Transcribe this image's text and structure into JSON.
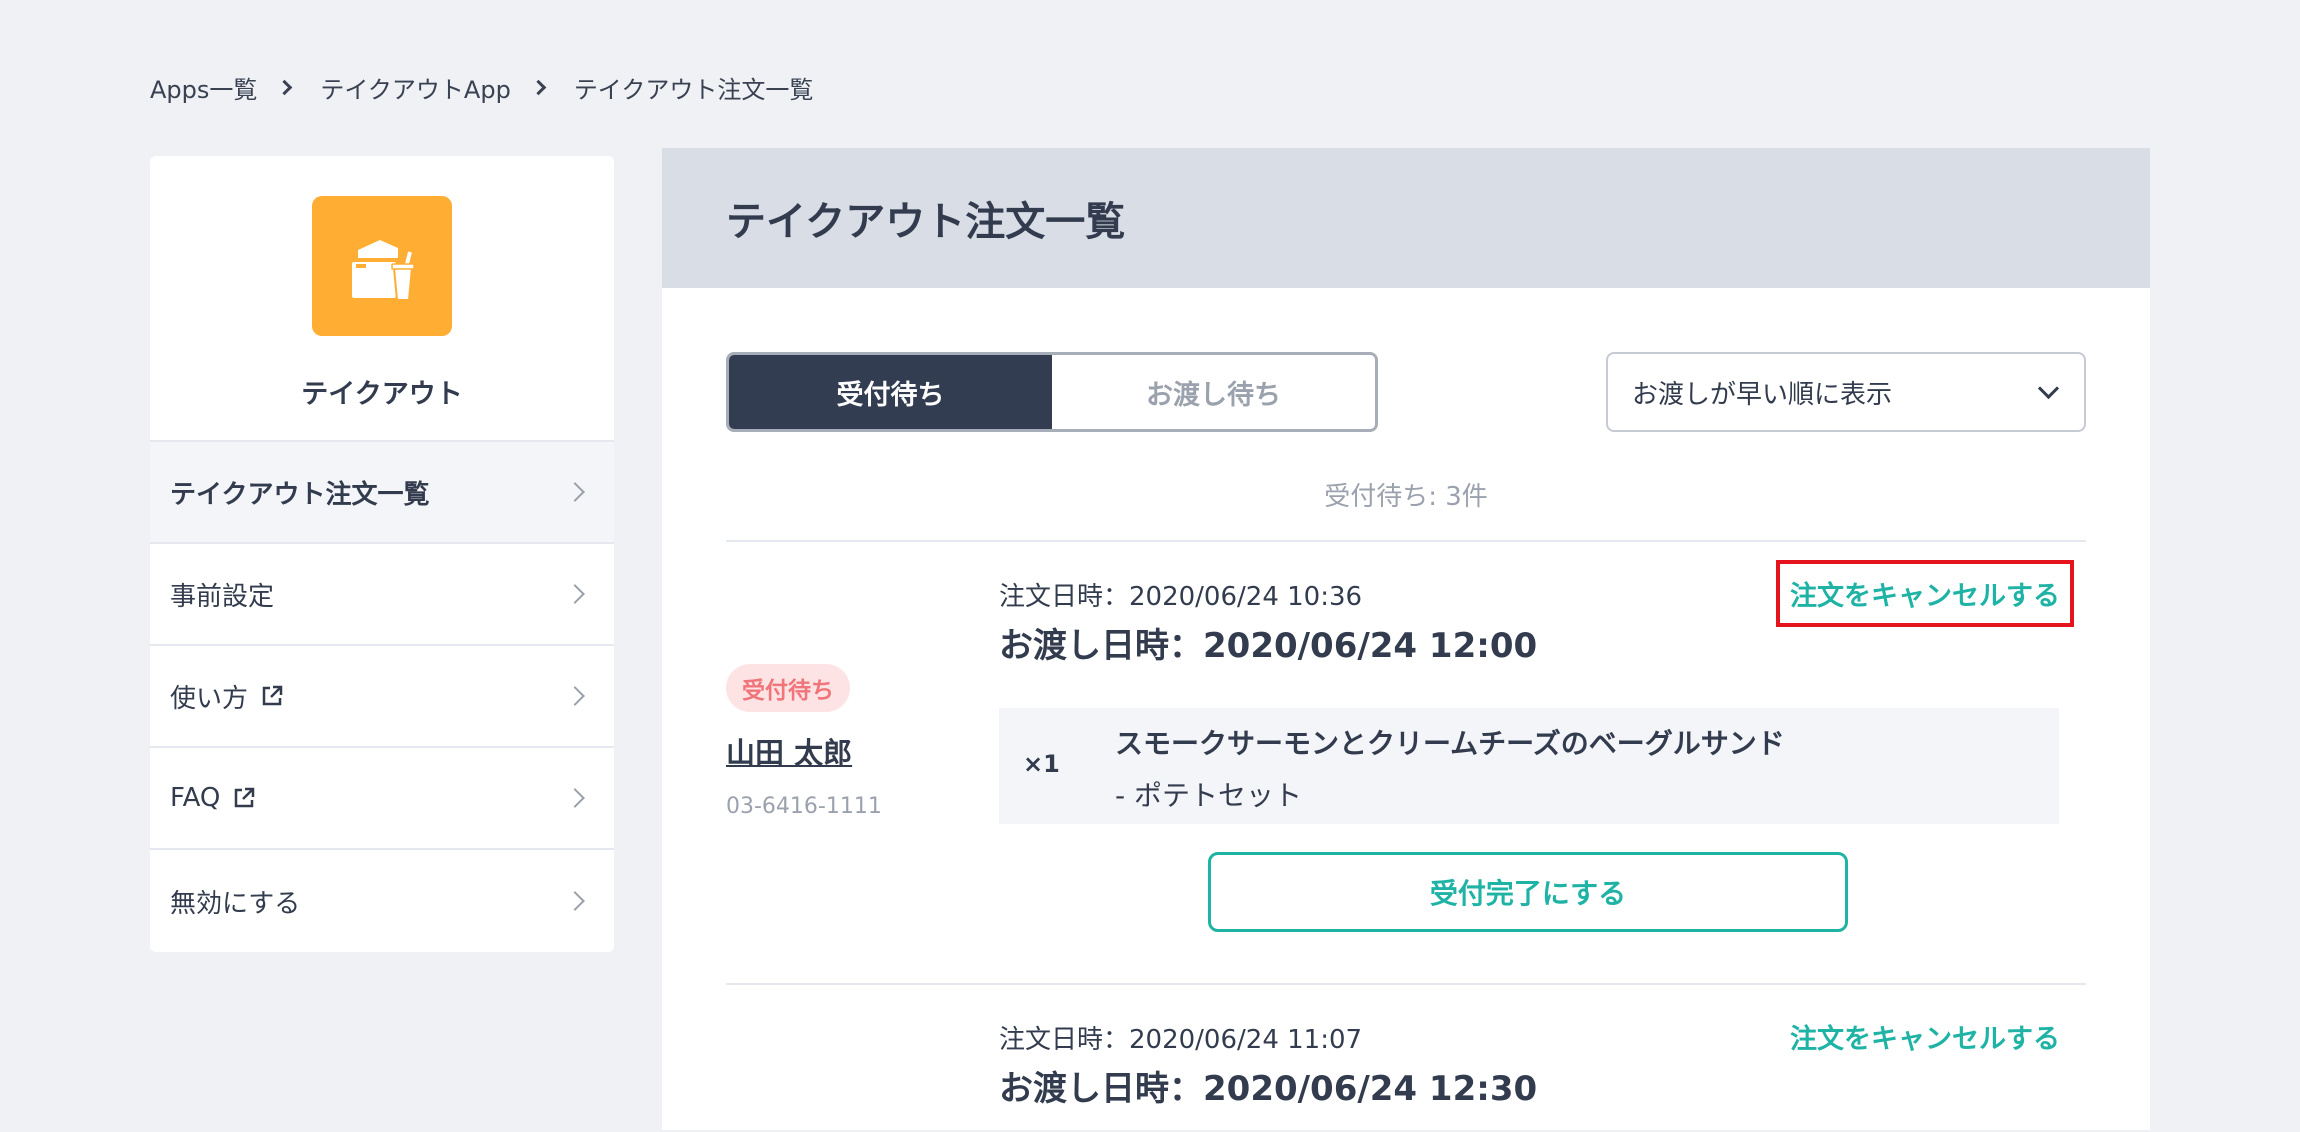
{
  "breadcrumb": {
    "items": [
      "Apps一覧",
      "テイクアウトApp",
      "テイクアウト注文一覧"
    ]
  },
  "sidebar": {
    "app_name": "テイクアウト",
    "app_icon": "takeout-bag-drink-icon",
    "app_icon_color": "#ffad33",
    "items": [
      {
        "label": "テイクアウト注文一覧",
        "external": false,
        "active": true
      },
      {
        "label": "事前設定",
        "external": false,
        "active": false
      },
      {
        "label": "使い方",
        "external": true,
        "active": false
      },
      {
        "label": "FAQ",
        "external": true,
        "active": false
      },
      {
        "label": "無効にする",
        "external": false,
        "active": false
      }
    ]
  },
  "main": {
    "title": "テイクアウト注文一覧",
    "tabs": [
      {
        "label": "受付待ち",
        "selected": true
      },
      {
        "label": "お渡し待ち",
        "selected": false
      }
    ],
    "sort": {
      "selected": "お渡しが早い順に表示"
    },
    "count_text": "受付待ち: 3件",
    "orders": [
      {
        "order_date": "注文日時：2020/06/24 10:36",
        "pickup_date": "お渡し日時：2020/06/24 12:00",
        "cancel_label": "注文をキャンセルする",
        "status": "受付待ち",
        "customer_name": "山田 太郎",
        "phone": "03-6416-1111",
        "item_qty": "×1",
        "item_name": "スモークサーモンとクリームチーズのベーグルサンド",
        "item_option": "-  ポテトセット",
        "accept_label": "受付完了にする"
      },
      {
        "order_date": "注文日時：2020/06/24 11:07",
        "pickup_date": "お渡し日時：2020/06/24 12:30",
        "cancel_label": "注文をキャンセルする"
      }
    ]
  },
  "colors": {
    "accent_teal": "#1fb3a6",
    "dark_navy": "#333d52",
    "badge_pink_bg": "#fde3e4",
    "badge_pink_text": "#f0757a",
    "highlight_red": "#e5141c"
  }
}
